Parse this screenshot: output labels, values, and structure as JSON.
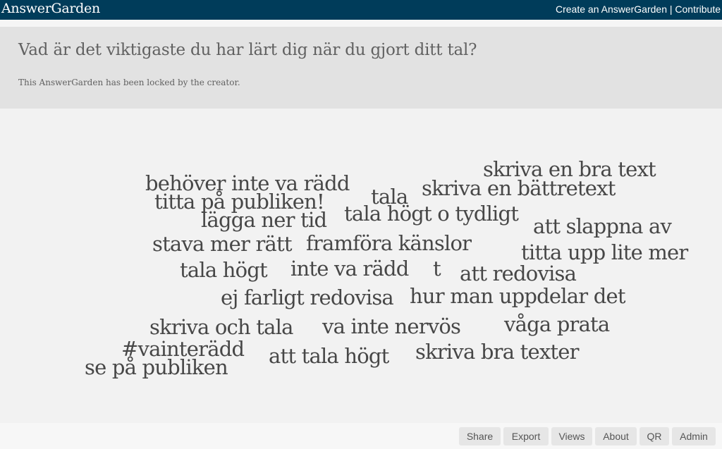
{
  "topbar": {
    "logo": "AnswerGarden",
    "links": {
      "create": "Create an AnswerGarden",
      "separator": " | ",
      "contribute": "Contribute"
    }
  },
  "header": {
    "question": "Vad är det viktigaste du har lärt dig när du gjort ditt tal?",
    "locked_message": "This AnswerGarden has been locked by the creator."
  },
  "answers": [
    "skriva en bra text",
    "behöver inte va rädd",
    "tala",
    "skriva en bättretext",
    "titta på publiken!",
    "tala högt o tydligt",
    "lägga ner tid",
    "att slappna av",
    "stava mer rätt",
    "framföra känslor",
    "titta upp lite mer",
    "tala högt",
    "inte va rädd",
    "t",
    "att redovisa",
    "ej farligt redovisa",
    "hur man uppdelar det",
    "skriva och tala",
    "va inte nervös",
    "våga prata",
    "#vainterädd",
    "att tala högt",
    "skriva bra texter",
    "se på publiken"
  ],
  "footer": {
    "buttons": {
      "share": "Share",
      "export": "Export",
      "views": "Views",
      "about": "About",
      "qr": "QR",
      "admin": "Admin"
    }
  },
  "colors": {
    "topbar": "#003c5a",
    "header_bg": "#e2e2e2",
    "garden_bg": "#f2f2f2",
    "answer_text": "#474747",
    "button_bg": "#e6e6e6"
  }
}
